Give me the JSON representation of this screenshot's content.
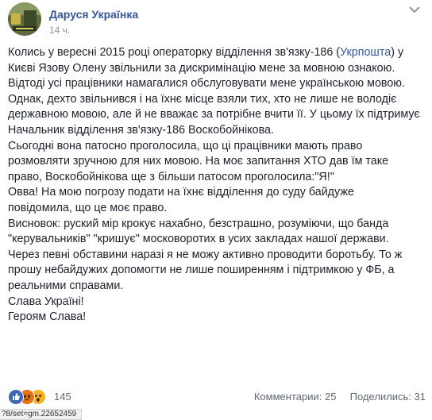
{
  "post": {
    "author": "Даруся Українка",
    "time": "14 ч.",
    "paragraphs": [
      {
        "before": "Колись у вересні 2015 році операторку відділення зв'язку-186 (",
        "mention": "Укрпошта",
        "after": ") у Києві Язову Олену звільнили за дискримінацію мене за мовною ознакою."
      },
      {
        "before": "Відтоді усі працівники намагалися обслуговувати мене українською мовою."
      },
      {
        "before": "Однак, дехто звільнився і на їхнє місце взяли тих, хто не лише не володіє державною мовою, але й не вважає за потрібне вчити її. У цьому їх підтримує Начальник відділення зв'язку-186 Воскобойнікова."
      },
      {
        "before": "Сьогодні вона патосно проголосила, що ці працівники мають право розмовляти зручною для них мовою. На моє запитання ХТО дав їм таке право, Воскобойнікова ще з більши патосом проголосила:\"Я!\""
      },
      {
        "before": "Овва! На мою погрозу подати на їхнє відділення до суду байдуже повідомила, що це моє право."
      },
      {
        "before": "Висновок: руский мір крокує нахабно, безстрашно, розуміючи, що банда \"керувальників\" \"кришує\" московоротих в усих закладах нашої держави."
      },
      {
        "before": "Через певні обставини наразі я не можу активно проводити боротьбу. То ж прошу небайдужих допомогти не лише поширенням і підтримкою у ФБ, а реальними справами."
      },
      {
        "before": "Слава Україні!"
      },
      {
        "before": "Героям Слава!"
      }
    ]
  },
  "reactions": {
    "icons": [
      "like-icon",
      "angry-icon",
      "wow-icon"
    ],
    "count": "145"
  },
  "stats": {
    "comments": "Комментарии: 25",
    "shares": "Поделились: 31"
  },
  "status_bar": {
    "url": "?8/set=gm.22652459"
  },
  "colors": {
    "link": "#365899",
    "text": "#1d2129",
    "meta": "#90949c",
    "like": "#4267b2",
    "angry": "#e9710f",
    "wow": "#f7b125"
  }
}
